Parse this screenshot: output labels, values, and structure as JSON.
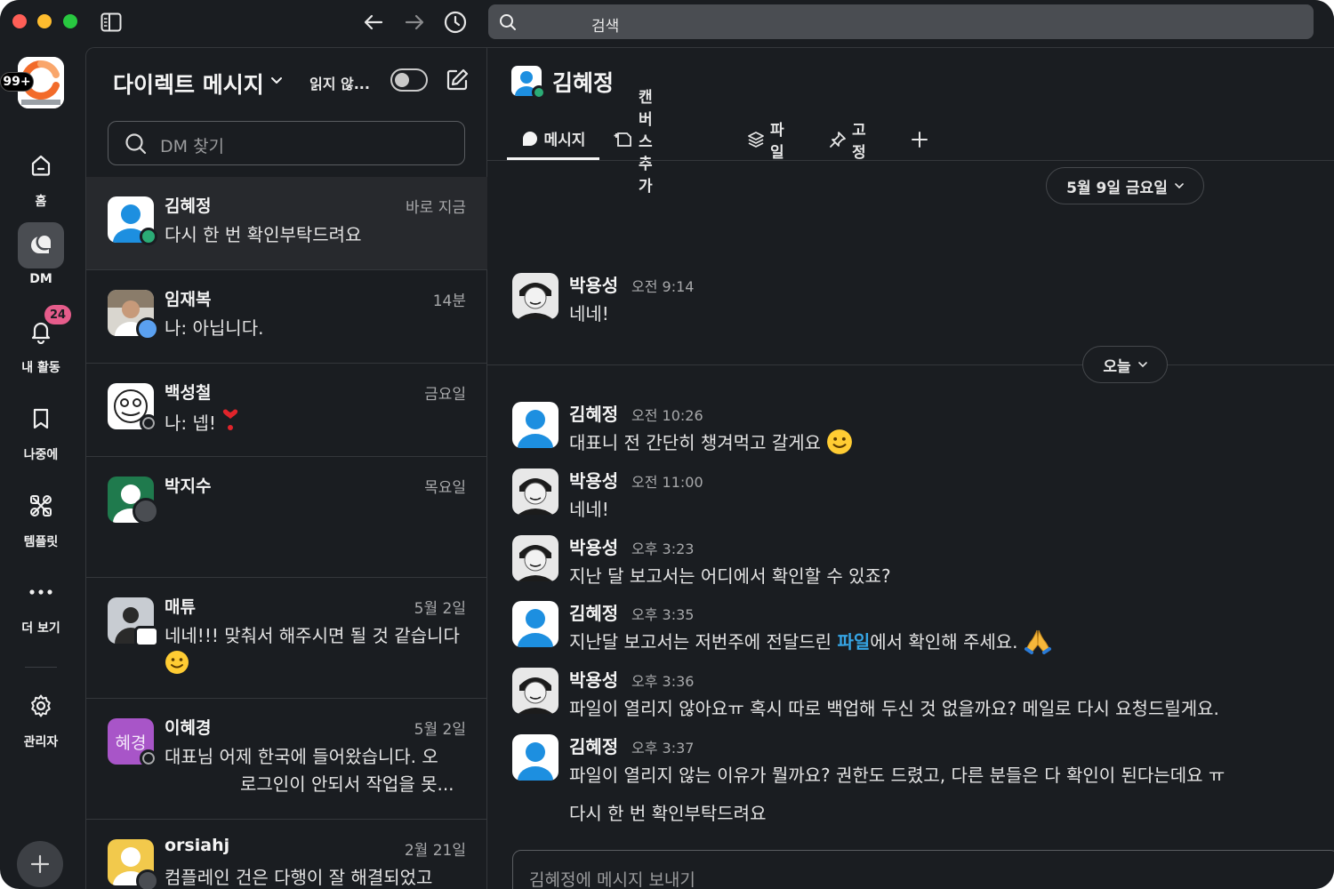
{
  "titlebar": {
    "search_placeholder": "검색"
  },
  "rail": {
    "workspace_badge": "99+",
    "items": [
      {
        "label": "홈",
        "icon": "home-icon"
      },
      {
        "label": "DM",
        "icon": "dm-icon",
        "active": true
      },
      {
        "label": "내 활동",
        "icon": "bell-icon",
        "count": "24"
      },
      {
        "label": "나중에",
        "icon": "bookmark-icon"
      },
      {
        "label": "템플릿",
        "icon": "templates-icon"
      },
      {
        "label": "더 보기",
        "icon": "more-icon"
      },
      {
        "label": "관리자",
        "icon": "gear-icon"
      }
    ]
  },
  "dm_panel": {
    "title": "다이렉트 메시지",
    "unread_label": "읽지 않...",
    "search_placeholder": "DM 찾기",
    "conversations": [
      {
        "name": "김혜정",
        "time": "바로 지금",
        "preview": "다시 한 번 확인부탁드려요",
        "active": true
      },
      {
        "name": "임재복",
        "time": "14분",
        "preview": "나: 아닙니다."
      },
      {
        "name": "백성철",
        "time": "금요일",
        "preview": "나: 넵!"
      },
      {
        "name": "박지수",
        "time": "목요일",
        "preview": ""
      },
      {
        "name": "매튜",
        "time": "5월 2일",
        "preview": "네네!!! 맞춰서 해주시면 될 것 같습니다"
      },
      {
        "name": "이혜경",
        "time": "5월 2일",
        "preview": "대표님 어제 한국에 들어왔습니다. 오",
        "preview_line2": "로그인이 안되서 작업을 못...",
        "avatar_text": "혜경"
      },
      {
        "name": "orsiahj",
        "time": "2월 21일",
        "preview": "컴플레인 건은 다행이 잘 해결되었고"
      }
    ]
  },
  "chat": {
    "header_name": "김혜정",
    "tabs": [
      {
        "label": "메시지",
        "active": true
      },
      {
        "label": "캔버스 추가"
      },
      {
        "label": "파일"
      },
      {
        "label": "고정"
      }
    ],
    "date_pills": [
      "5월 9일 금요일",
      "오늘"
    ],
    "messages": [
      {
        "name": "박용성",
        "time": "오전 9:14",
        "text": "네네!"
      },
      {
        "name": "김혜정",
        "time": "오전 10:26",
        "text": "대표니 전 간단히 챙겨먹고 갈게요"
      },
      {
        "name": "박용성",
        "time": "오전 11:00",
        "text": "네네!"
      },
      {
        "name": "박용성",
        "time": "오후 3:23",
        "text": "지난 달 보고서는 어디에서 확인할 수 있죠?"
      },
      {
        "name": "김혜정",
        "time": "오후 3:35",
        "text_before": "지난달 보고서는 저번주에 전달드린 ",
        "link": "파일",
        "text_after": "에서 확인해 주세요."
      },
      {
        "name": "박용성",
        "time": "오후 3:36",
        "text": "파일이 열리지 않아요ㅠ 혹시 따로 백업해 두신 것 없을까요? 메일로 다시 요청드릴게요."
      },
      {
        "name": "김혜정",
        "time": "오후 3:37",
        "text": "파일이 열리지 않는 이유가 뭘까요? 권한도 드렸고, 다른 분들은 다 확인이 된다는데요 ㅠ",
        "text2": "다시 한 번 확인부탁드려요"
      }
    ],
    "composer_placeholder": "김혜정에 메시지 보내기"
  },
  "colors": {
    "background": "#1a1d21",
    "link": "#36a6e6",
    "badge": "#e65c8b",
    "online": "#2bac76"
  }
}
